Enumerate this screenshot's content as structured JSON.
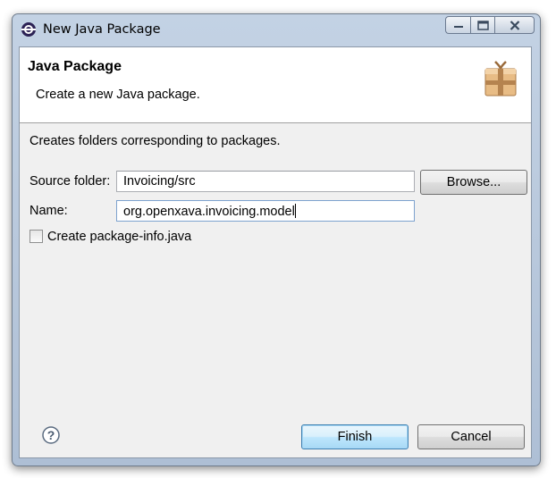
{
  "window": {
    "title": "New Java Package"
  },
  "banner": {
    "title": "Java Package",
    "description": "Create a new Java package.",
    "icon": "package-icon"
  },
  "form": {
    "info": "Creates folders corresponding to packages.",
    "source_folder_label": "Source folder:",
    "source_folder_value": "Invoicing/src",
    "browse_label": "Browse...",
    "name_label": "Name:",
    "name_value": "org.openxava.invoicing.model",
    "package_info_label": "Create package-info.java",
    "package_info_checked": false
  },
  "footer": {
    "help_icon": "help-icon",
    "finish_label": "Finish",
    "cancel_label": "Cancel"
  }
}
